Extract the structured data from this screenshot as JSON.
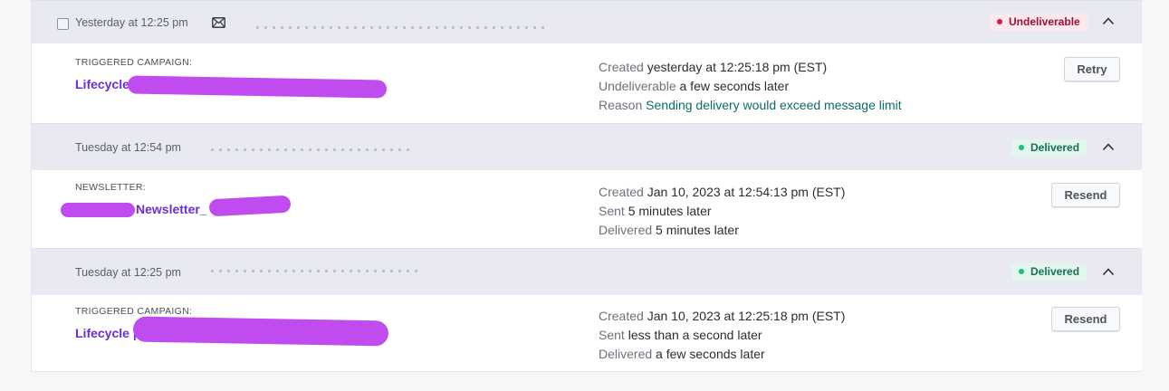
{
  "messages": [
    {
      "date": "Yesterday at 12:25 pm",
      "status": "Undeliverable",
      "type_label": "TRIGGERED CAMPAIGN:",
      "campaign": "Lifecycle | ",
      "line1_key": "Created",
      "line1_val": "yesterday at 12:25:18 pm (EST)",
      "line2_key": "Undeliverable",
      "line2_val": "a few seconds later",
      "line3_key": "Reason",
      "line3_val": "Sending delivery would exceed message limit",
      "action": "Retry"
    },
    {
      "date": "Tuesday at 12:54 pm",
      "status": "Delivered",
      "type_label": "NEWSLETTER:",
      "campaign": "Newsletter_",
      "line1_key": "Created",
      "line1_val": "Jan 10, 2023 at 12:54:13 pm (EST)",
      "line2_key": "Sent",
      "line2_val": "5 minutes later",
      "line3_key": "Delivered",
      "line3_val": "5 minutes later",
      "action": "Resend"
    },
    {
      "date": "Tuesday at 12:25 pm",
      "status": "Delivered",
      "type_label": "TRIGGERED CAMPAIGN:",
      "campaign": "Lifecycle | ",
      "line1_key": "Created",
      "line1_val": "Jan 10, 2023 at 12:25:18 pm (EST)",
      "line2_key": "Sent",
      "line2_val": "less than a second later",
      "line3_key": "Delivered",
      "line3_val": "a few seconds later",
      "action": "Resend"
    }
  ],
  "icons": {
    "envelope": "envelope-icon",
    "chevron": "chevron-up-icon",
    "status_dot": "status-dot-icon"
  },
  "colors": {
    "undeliverable_text": "#9b1035",
    "undeliverable_bg": "#fde8ee",
    "delivered_text": "#157252",
    "delivered_bg": "#e2f6ee",
    "campaign_link": "#6a2ed6",
    "reason_text": "#0f6b67"
  }
}
